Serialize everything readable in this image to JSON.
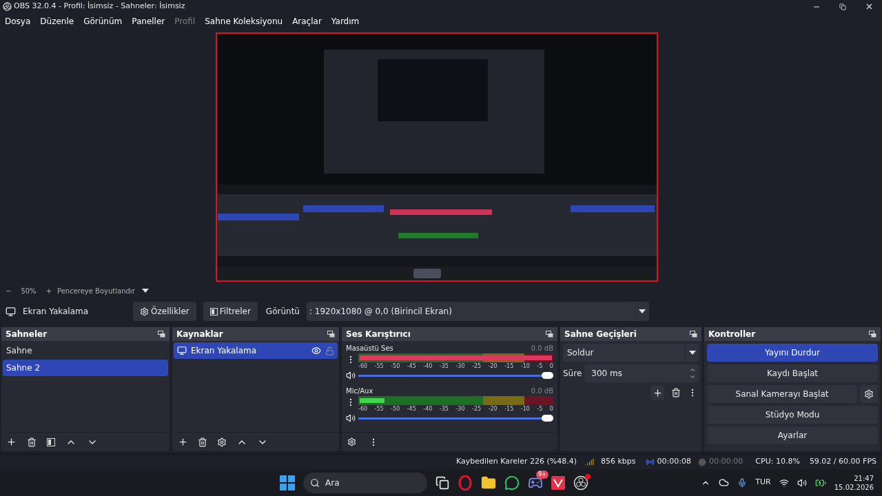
{
  "window": {
    "title": "OBS 32.0.4 - Profil: İsimsiz - Sahneler: İsimsiz"
  },
  "menu": [
    {
      "label": "Dosya",
      "disabled": false
    },
    {
      "label": "Düzenle",
      "disabled": false
    },
    {
      "label": "Görünüm",
      "disabled": false
    },
    {
      "label": "Paneller",
      "disabled": false
    },
    {
      "label": "Profil",
      "disabled": true
    },
    {
      "label": "Sahne Koleksiyonu",
      "disabled": false
    },
    {
      "label": "Araçlar",
      "disabled": false
    },
    {
      "label": "Yardım",
      "disabled": false
    }
  ],
  "zoom_bar": {
    "minus": "−",
    "zoom": "50%",
    "plus": "+",
    "fit": "Pencereye Boyutlandır"
  },
  "source_toolbar": {
    "source": "Ekran Yakalama",
    "properties": "Özellikler",
    "filters": "Filtreler",
    "display_label": "Görüntü",
    "display_value": ": 1920x1080 @ 0,0 (Birincil Ekran)"
  },
  "scenes": {
    "title": "Sahneler",
    "items": [
      {
        "label": "Sahne",
        "selected": false
      },
      {
        "label": "Sahne 2",
        "selected": true
      }
    ]
  },
  "sources": {
    "title": "Kaynaklar",
    "items": [
      {
        "label": "Ekran Yakalama",
        "selected": true,
        "visible": true,
        "locked": false
      }
    ]
  },
  "mixer": {
    "title": "Ses Karıştırıcı",
    "channels": [
      {
        "name": "Masaüstü Ses",
        "reading": "0.0 dB",
        "level": 1,
        "clipping": true,
        "volume": {
          "level": 1
        },
        "ticks": [
          "-60",
          "-55",
          "-50",
          "-45",
          "-40",
          "-35",
          "-30",
          "-25",
          "-20",
          "-15",
          "-10",
          "-5",
          "0"
        ]
      },
      {
        "name": "Mic/Aux",
        "reading": "0.0 dB",
        "level": 0.13,
        "clipping": false,
        "volume": {
          "level": 1
        },
        "ticks": [
          "-60",
          "-55",
          "-50",
          "-45",
          "-40",
          "-35",
          "-30",
          "-25",
          "-20",
          "-15",
          "-10",
          "-5",
          "0"
        ]
      }
    ]
  },
  "transitions": {
    "title": "Sahne Geçişleri",
    "transition": "Soldur",
    "duration_label": "Süre",
    "duration": "300 ms"
  },
  "controls": {
    "title": "Kontroller",
    "buttons": [
      {
        "label": "Yayını Durdur",
        "active": true,
        "settings": false
      },
      {
        "label": "Kaydı Başlat",
        "active": false,
        "settings": false
      },
      {
        "label": "Sanal Kamerayı Başlat",
        "active": false,
        "settings": true
      },
      {
        "label": "Stüdyo Modu",
        "active": false,
        "settings": false
      },
      {
        "label": "Ayarlar",
        "active": false,
        "settings": false
      }
    ]
  },
  "status_bar": {
    "dropped": "Kaybedilen Kareler 226 (%48.4)",
    "bitrate": "856 kbps",
    "stream_time": "00:00:08",
    "record_time": "00:00:00",
    "recording": false,
    "cpu": "CPU: 10.8%",
    "fps": "59.02 / 60.00 FPS"
  },
  "taskbar": {
    "search": "Ara",
    "discord_badge": "9+",
    "language": "TUR",
    "time": "21:47",
    "date": "15.02.2026"
  }
}
